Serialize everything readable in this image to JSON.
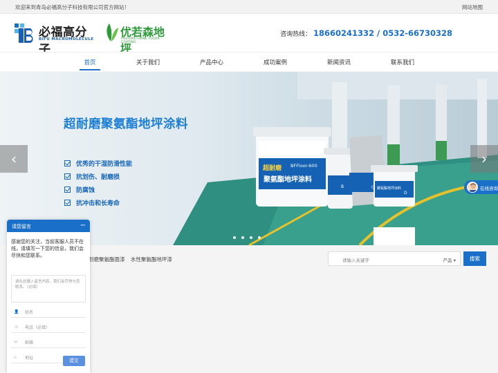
{
  "topbar": {
    "welcome": "欢迎来到青岛必福高分子科技有限公司官方网站！",
    "sitemap": "网站地图"
  },
  "header": {
    "logo_primary": {
      "cn": "必福高分子",
      "en": "BIFU MACROMOLECULE"
    },
    "logo_secondary": {
      "cn": "优若森地坪",
      "en": "POLYURETHANE FLOOR COATING"
    },
    "hotline_label": "咨询热线：",
    "hotline_numbers": "18660241332 / 0532-66730328"
  },
  "nav": {
    "items": [
      {
        "label": "首页",
        "active": true
      },
      {
        "label": "关于我们",
        "active": false
      },
      {
        "label": "产品中心",
        "active": false
      },
      {
        "label": "成功案例",
        "active": false
      },
      {
        "label": "新闻资讯",
        "active": false
      },
      {
        "label": "联系我们",
        "active": false
      }
    ]
  },
  "banner": {
    "slogan": "超耐磨聚氨酯地坪涂料",
    "features": [
      "优秀的干湿防滑性能",
      "抗划伤、耐磨损",
      "防腐蚀",
      "抗冲击和长寿命"
    ],
    "product_label_big": "超耐磨",
    "product_label_sub": "聚氨酯地坪涂料",
    "product_model": "BFFloor-600",
    "product_small_label": "聚氨酯地坪涂料",
    "bucket_letters": [
      "A",
      "B",
      "C",
      "D"
    ],
    "slide_count": 4,
    "active_slide": 0,
    "prev_arrow": "‹",
    "next_arrow": "›"
  },
  "search": {
    "hotwords": [
      "耐磨聚氨酯面漆",
      "水性聚氨酯地坪漆"
    ],
    "placeholder": "请输入关键字",
    "type_label": "产品",
    "button_label": "搜索"
  },
  "consult": {
    "label": "在线咨询"
  },
  "chat": {
    "title": "请您留言",
    "minimize": "−",
    "message": "感谢您的关注，当前客服人员不在线，请填写一下您的信息，我们会尽快和您联系。",
    "textarea_placeholder": "请在此输入留言内容，我们会尽快与您联系。（必填）",
    "fields": [
      {
        "icon": "user-icon",
        "glyph": "👤",
        "placeholder": "姓名"
      },
      {
        "icon": "phone-icon",
        "glyph": "☏",
        "placeholder": "电话（必填）"
      },
      {
        "icon": "mail-icon",
        "glyph": "✉",
        "placeholder": "邮箱"
      },
      {
        "icon": "location-icon",
        "glyph": "⌂",
        "placeholder": "地址"
      }
    ],
    "submit": "提交"
  },
  "colors": {
    "accent": "#1a6fc9",
    "green": "#2e9a3a",
    "slogan": "#1d7fd4"
  }
}
